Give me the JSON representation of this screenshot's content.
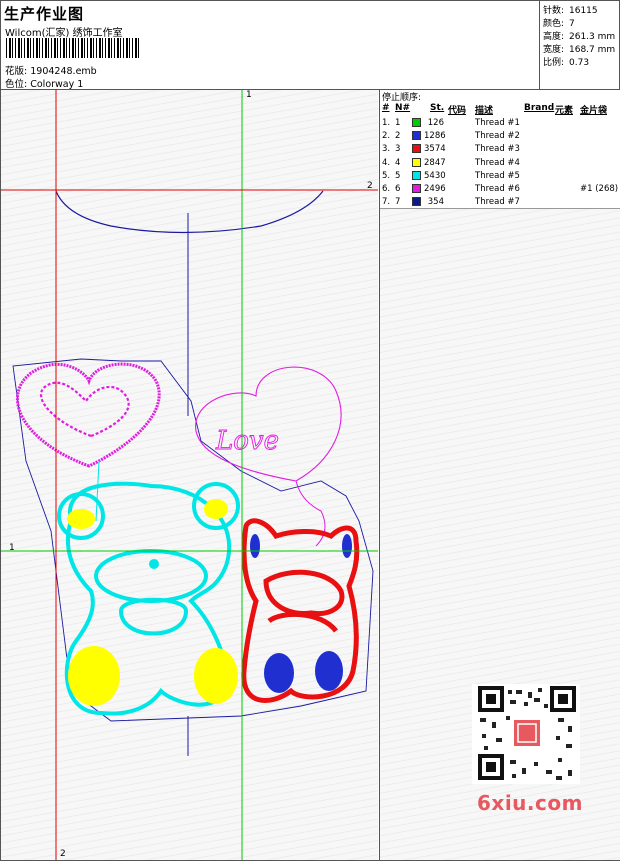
{
  "header": {
    "title": "生产作业图",
    "studio": "Wilcom(汇家) 绣饰工作室",
    "design_label": "花版:",
    "design_value": "1904248.emb",
    "colorway_label": "色位:",
    "colorway_value": "Colorway 1"
  },
  "stats": [
    {
      "label": "针数:",
      "value": "16115"
    },
    {
      "label": "颜色:",
      "value": "7"
    },
    {
      "label": "高度:",
      "value": "261.3 mm"
    },
    {
      "label": "宽度:",
      "value": "168.7 mm"
    },
    {
      "label": "比例:",
      "value": "0.73"
    }
  ],
  "guides": {
    "v1": "1",
    "v2": "2",
    "h1": "1",
    "h2": "2"
  },
  "sequence": {
    "title": "停止顺序:",
    "headers": {
      "num": "#",
      "n": "N#",
      "st": "St.",
      "code": "代码",
      "desc": "描述",
      "brand": "Brand",
      "elem": "元素",
      "seq": "金片袋"
    },
    "rows": [
      {
        "num": "1.",
        "n": "1",
        "color": "#00cc00",
        "st": "126",
        "desc": "Thread #1",
        "extra": ""
      },
      {
        "num": "2.",
        "n": "2",
        "color": "#1f2fd0",
        "st": "1286",
        "desc": "Thread #2",
        "extra": ""
      },
      {
        "num": "3.",
        "n": "3",
        "color": "#e81010",
        "st": "3574",
        "desc": "Thread #3",
        "extra": ""
      },
      {
        "num": "4.",
        "n": "4",
        "color": "#ffff00",
        "st": "2847",
        "desc": "Thread #4",
        "extra": ""
      },
      {
        "num": "5.",
        "n": "5",
        "color": "#00e5e5",
        "st": "5430",
        "desc": "Thread #5",
        "extra": ""
      },
      {
        "num": "6.",
        "n": "6",
        "color": "#e01ee0",
        "st": "2496",
        "desc": "Thread #6",
        "extra": "#1 (268)"
      },
      {
        "num": "7.",
        "n": "7",
        "color": "#0a1a8a",
        "st": "354",
        "desc": "Thread #7",
        "extra": ""
      }
    ]
  },
  "embroidery": {
    "love_text": "Love"
  },
  "watermark": "6xiu.com",
  "colors": {
    "guide_green": "#00c800",
    "guide_red": "#e00000",
    "outline_blue": "#1a1aa0"
  }
}
